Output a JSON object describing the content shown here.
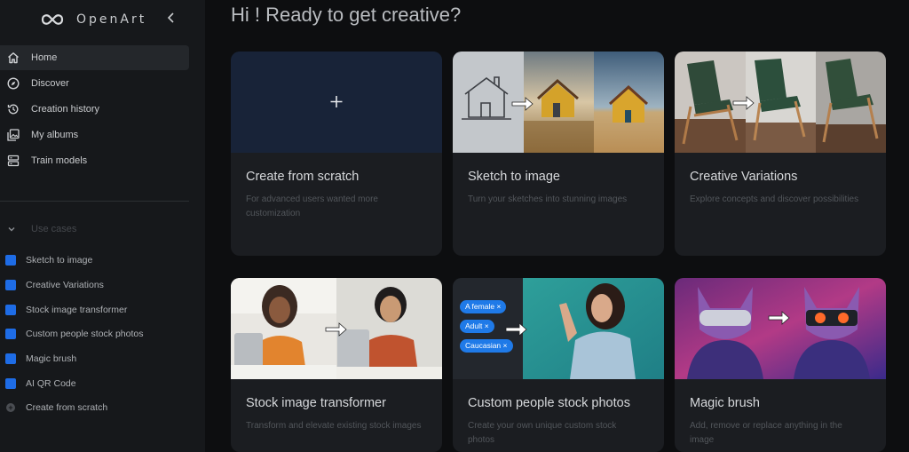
{
  "app": {
    "name": "OpenArt"
  },
  "sidebar": {
    "nav": [
      {
        "label": "Home",
        "icon": "home-icon",
        "active": true
      },
      {
        "label": "Discover",
        "icon": "compass-icon",
        "active": false
      },
      {
        "label": "Creation history",
        "icon": "history-icon",
        "active": false
      },
      {
        "label": "My albums",
        "icon": "album-icon",
        "active": false
      },
      {
        "label": "Train models",
        "icon": "server-icon",
        "active": false
      }
    ],
    "use_cases_title": "Use cases",
    "use_cases": [
      "Sketch to image",
      "Creative Variations",
      "Stock image transformer",
      "Custom people stock photos",
      "Magic brush",
      "AI QR Code"
    ],
    "create_label": "Create from scratch"
  },
  "main": {
    "headline": "Hi ! Ready to get creative?",
    "cards": [
      {
        "title": "Create from scratch",
        "desc": "For advanced users wanted more customization",
        "media_icon": "plus-icon"
      },
      {
        "title": "Sketch to image",
        "desc": "Turn your sketches into stunning images"
      },
      {
        "title": "Creative Variations",
        "desc": "Explore concepts and discover possibilities"
      },
      {
        "title": "Stock image transformer",
        "desc": "Transform and elevate existing stock images"
      },
      {
        "title": "Custom people stock photos",
        "desc": "Create your own unique custom stock photos",
        "chips": [
          "A female ×",
          "Adult ×",
          "Caucasian ×"
        ]
      },
      {
        "title": "Magic brush",
        "desc": "Add, remove or replace anything in the image"
      }
    ]
  },
  "colors": {
    "accent": "#1e6ce6",
    "sidebar_bg": "#16181b",
    "page_bg": "#0d0e10",
    "card_bg": "#1b1d21",
    "create_media_bg": "#182338"
  }
}
